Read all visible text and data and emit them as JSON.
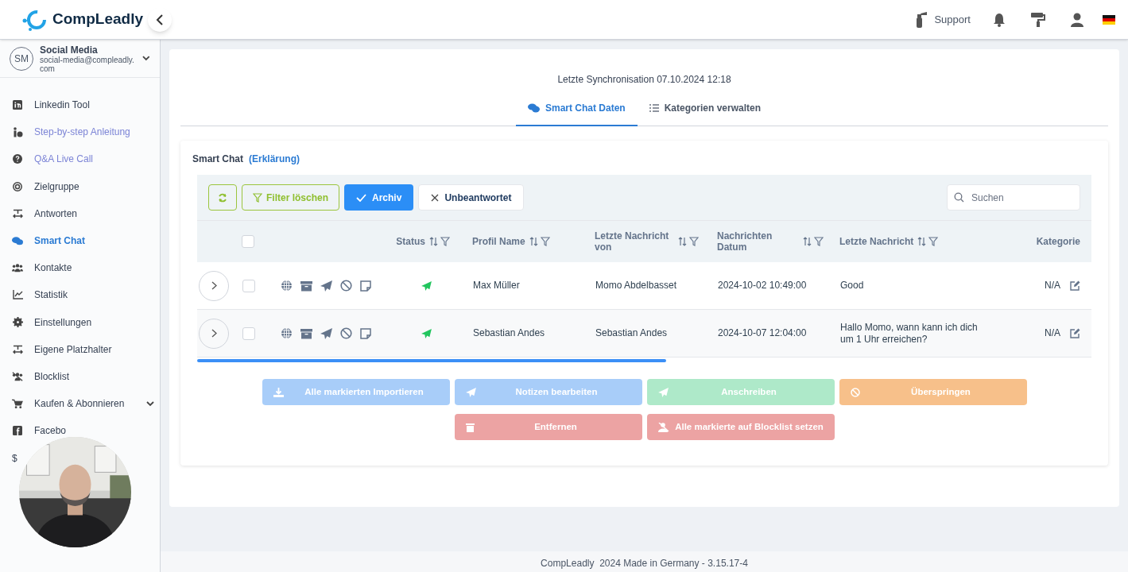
{
  "header": {
    "logo": "CompLeadly",
    "support": "Support"
  },
  "account": {
    "initials": "SM",
    "name": "Social Media",
    "email": "social-media@compleadly.com"
  },
  "sidebar": {
    "items": [
      {
        "label": "Linkedin Tool",
        "selected": false,
        "accent": false
      },
      {
        "label": "Step-by-step Anleitung",
        "selected": false,
        "accent": true
      },
      {
        "label": "Q&A Live Call",
        "selected": false,
        "accent": true
      },
      {
        "label": "Zielgruppe",
        "selected": false,
        "accent": false
      },
      {
        "label": "Antworten",
        "selected": false,
        "accent": false
      },
      {
        "label": "Smart Chat",
        "selected": true,
        "accent": false
      },
      {
        "label": "Kontakte",
        "selected": false,
        "accent": false
      },
      {
        "label": "Statistik",
        "selected": false,
        "accent": false
      },
      {
        "label": "Einstellungen",
        "selected": false,
        "accent": false
      },
      {
        "label": "Eigene Platzhalter",
        "selected": false,
        "accent": false
      },
      {
        "label": "Blocklist",
        "selected": false,
        "accent": false
      },
      {
        "label": "Kaufen & Abonnieren",
        "selected": false,
        "accent": false,
        "expandable": true
      },
      {
        "label": "Facebo",
        "selected": false,
        "accent": false
      },
      {
        "label": "$",
        "selected": false,
        "accent": false
      }
    ]
  },
  "sync": "Letzte Synchronisation 07.10.2024 12:18",
  "tabs": [
    {
      "label": "Smart Chat Daten",
      "selected": true
    },
    {
      "label": "Kategorien verwalten",
      "selected": false
    }
  ],
  "card": {
    "title": "Smart Chat",
    "link": "(Erklärung)"
  },
  "toolbar": {
    "clear_filter": "Filter löschen",
    "toggles": [
      {
        "label": "Archiv",
        "selected": true
      },
      {
        "label": "Unbeantwortet",
        "selected": false
      }
    ],
    "search": {
      "placeholder": "Suchen"
    }
  },
  "table": {
    "select_all_checked": false,
    "columns": [
      "Status",
      "Profil Name",
      "Letzte Nachricht von",
      "Nachrichten Datum",
      "Letzte Nachricht",
      "Kategorie"
    ],
    "rows": [
      {
        "checked": false,
        "profile": "Max Müller",
        "from": "Momo Abdelbasset",
        "date": "2024-10-02 10:49:00",
        "message": "Good",
        "category": "N/A"
      },
      {
        "checked": false,
        "profile": "Sebastian Andes",
        "from": "Sebastian Andes",
        "date": "2024-10-07 12:04:00",
        "message": "Hallo Momo, wann kann ich dich um 1 Uhr erreichen?",
        "category": "N/A"
      }
    ]
  },
  "actions": [
    {
      "label": "Alle markierten Importieren",
      "color": "#a8cdf9",
      "disabled": true
    },
    {
      "label": "Notizen bearbeiten",
      "color": "#a8cdf9",
      "disabled": true
    },
    {
      "label": "Anschreiben",
      "color": "#aee9c9",
      "disabled": true
    },
    {
      "label": "Überspringen",
      "color": "#f7c08a",
      "disabled": true
    },
    {
      "label": "Entfernen",
      "color": "#eca3a3",
      "disabled": true
    },
    {
      "label": "Alle markierte auf Blocklist setzen",
      "color": "#eca3a3",
      "disabled": true
    }
  ],
  "footer": "CompLeadly  2024 Made in Germany - 3.15.17-4"
}
